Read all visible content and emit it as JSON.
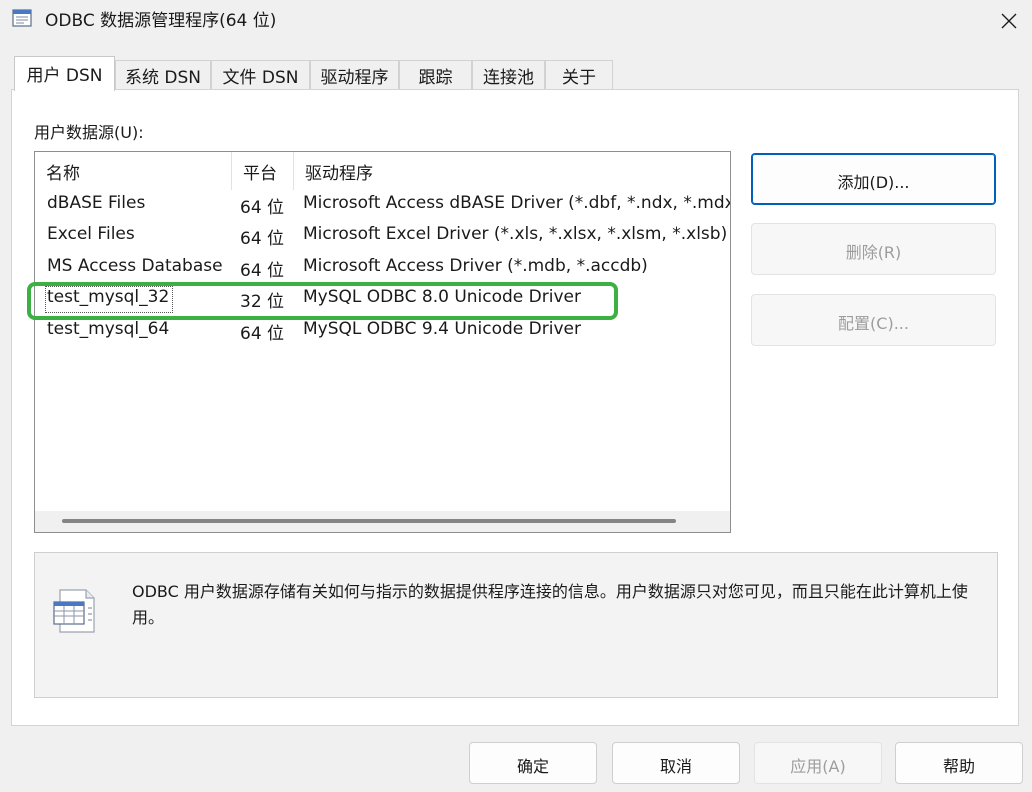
{
  "window": {
    "title": "ODBC 数据源管理程序(64 位)",
    "icon": "odbc-app-icon",
    "close_icon": "close-icon"
  },
  "tabs": [
    {
      "label": "用户 DSN",
      "active": true
    },
    {
      "label": "系统 DSN",
      "active": false
    },
    {
      "label": "文件 DSN",
      "active": false
    },
    {
      "label": "驱动程序",
      "active": false
    },
    {
      "label": "跟踪",
      "active": false
    },
    {
      "label": "连接池",
      "active": false
    },
    {
      "label": "关于",
      "active": false
    }
  ],
  "panel": {
    "group_label": "用户数据源(U):",
    "columns": [
      "名称",
      "平台",
      "驱动程序"
    ],
    "rows": [
      {
        "name": "dBASE Files",
        "platform": "64 位",
        "driver": "Microsoft Access dBASE Driver (*.dbf, *.ndx, *.mdx)"
      },
      {
        "name": "Excel Files",
        "platform": "64 位",
        "driver": "Microsoft Excel Driver (*.xls, *.xlsx, *.xlsm, *.xlsb)"
      },
      {
        "name": "MS Access Database",
        "platform": "64 位",
        "driver": "Microsoft Access Driver (*.mdb, *.accdb)"
      },
      {
        "name": "test_mysql_32",
        "platform": "32 位",
        "driver": "MySQL ODBC 8.0 Unicode Driver"
      },
      {
        "name": "test_mysql_64",
        "platform": "64 位",
        "driver": "MySQL ODBC 9.4 Unicode Driver"
      }
    ],
    "highlight_color": "#3cb043"
  },
  "side_buttons": {
    "add": "添加(D)...",
    "remove": "删除(R)",
    "configure": "配置(C)..."
  },
  "info": {
    "icon": "datasource-icon",
    "text": "ODBC 用户数据源存储有关如何与指示的数据提供程序连接的信息。用户数据源只对您可见，而且只能在此计算机上使用。"
  },
  "footer": {
    "ok": "确定",
    "cancel": "取消",
    "apply": "应用(A)",
    "help": "帮助"
  },
  "colors": {
    "accent": "#005fb8",
    "window_bg": "#f0f0f0",
    "disabled_text": "#9d9d9d"
  }
}
